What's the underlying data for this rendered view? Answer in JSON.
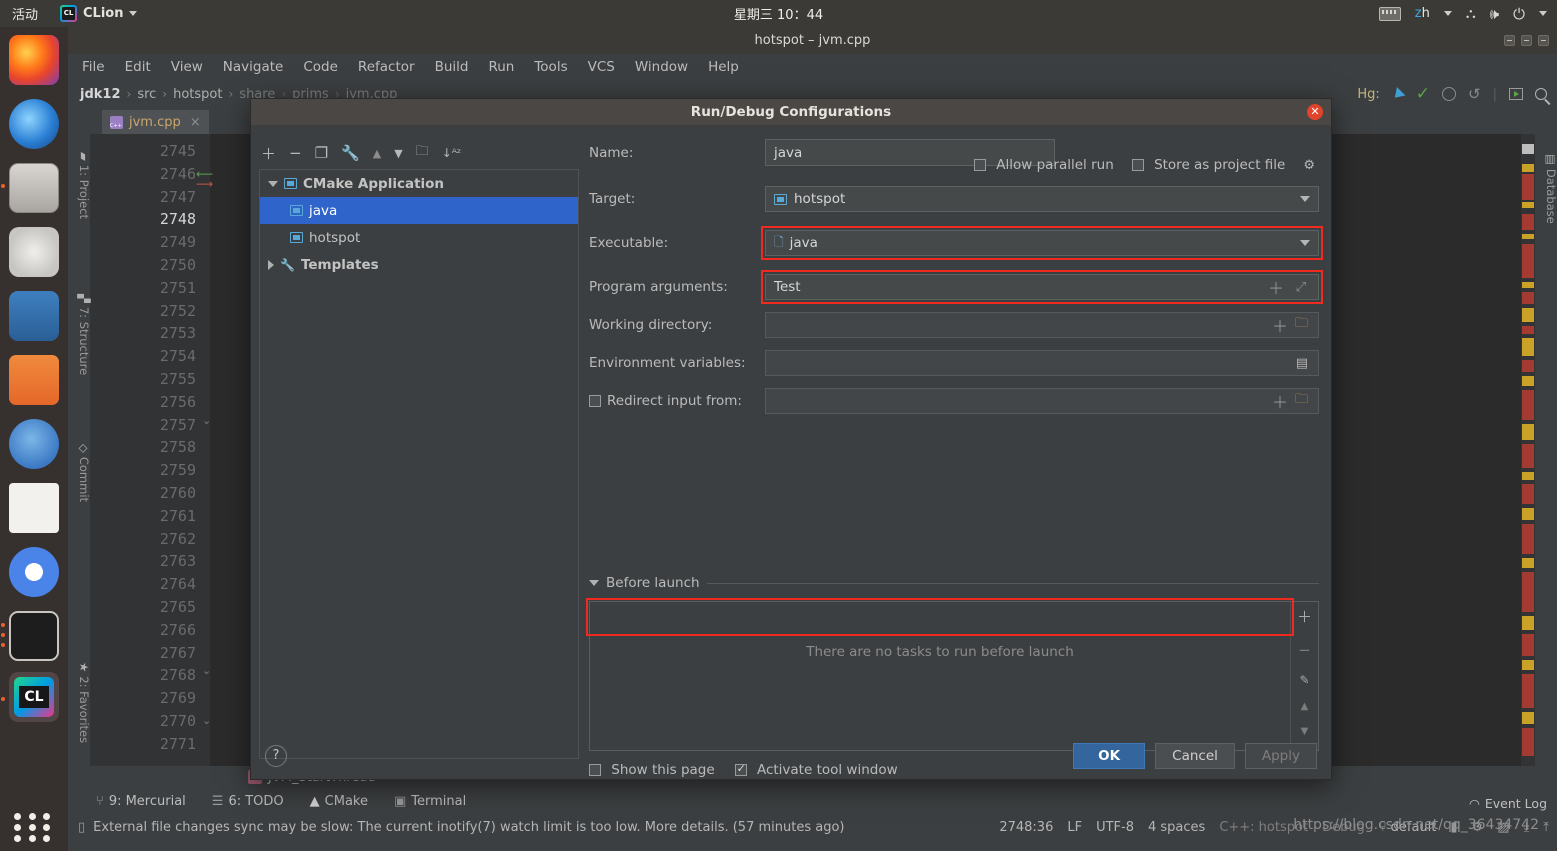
{
  "gnome": {
    "activities": "活动",
    "app_name": "CLion",
    "clock": "星期三 10：44",
    "language": "zh",
    "icons": [
      "keyboard-icon",
      "network-icon",
      "volume-icon",
      "power-icon"
    ]
  },
  "dock": {
    "items": [
      {
        "name": "firefox",
        "running": false
      },
      {
        "name": "thunderbird",
        "running": false
      },
      {
        "name": "files",
        "running": true
      },
      {
        "name": "rhythmbox",
        "running": false
      },
      {
        "name": "libreoffice-writer",
        "running": false
      },
      {
        "name": "ubuntu-software",
        "running": false
      },
      {
        "name": "help",
        "running": false
      },
      {
        "name": "amazon",
        "running": false
      },
      {
        "name": "chromium",
        "running": false
      },
      {
        "name": "terminal",
        "running": true
      },
      {
        "name": "clion",
        "running": true
      }
    ],
    "show_apps": "show-applications-icon"
  },
  "ide": {
    "window_title": "hotspot – jvm.cpp",
    "menu": [
      "File",
      "Edit",
      "View",
      "Navigate",
      "Code",
      "Refactor",
      "Build",
      "Run",
      "Tools",
      "VCS",
      "Window",
      "Help"
    ],
    "breadcrumbs": [
      "jdk12",
      "src",
      "hotspot",
      "share",
      "prims",
      "jvm.cpp"
    ],
    "vcs_label": "Hg:",
    "tab": {
      "label": "jvm.cpp",
      "icon": "cpp-file-icon",
      "close": "×"
    },
    "left_strips": [
      "1: Project",
      "7: Structure",
      "Commit",
      "2: Favorites"
    ],
    "right_strips": [
      "Database"
    ],
    "line_numbers": [
      "2745",
      "2746",
      "2747",
      "2748",
      "2749",
      "2750",
      "2751",
      "2752",
      "2753",
      "2754",
      "2755",
      "2756",
      "2757",
      "2758",
      "2759",
      "2760",
      "2761",
      "2762",
      "2763",
      "2764",
      "2765",
      "2766",
      "2767",
      "2768",
      "2769",
      "2770",
      "2771"
    ],
    "current_line": "2748",
    "structure_breadcrumb": "JVM_StartThread",
    "tool_windows": [
      {
        "label": "9: Mercurial",
        "icon": "branch-icon"
      },
      {
        "label": "6: TODO",
        "icon": "list-icon"
      },
      {
        "label": "CMake",
        "icon": "triangle-icon"
      },
      {
        "label": "Terminal",
        "icon": "terminal-icon"
      }
    ],
    "status": {
      "message": "External file changes sync may be slow: The current inotify(7) watch limit is too low. More details. (57 minutes ago)",
      "caret": "2748:36",
      "line_sep": "LF",
      "encoding": "UTF-8",
      "indent": "4 spaces",
      "build_target": "C++: hotspot",
      "debug": "Debug",
      "branch": "default",
      "event_log": "Event Log"
    },
    "watermark": "https://blog.csdn.net/qq_36434742"
  },
  "dialog": {
    "title": "Run/Debug Configurations",
    "close_icon": "close-icon",
    "toolbar_icons": [
      "add-icon",
      "remove-icon",
      "copy-icon",
      "edit-templates-icon",
      "move-up-icon",
      "move-down-icon",
      "move-into-folder-icon",
      "sort-alphabetically-icon"
    ],
    "tree": [
      {
        "label": "CMake Application",
        "level": 0,
        "expanded": true,
        "selected": false,
        "icon": "cmake-app-icon"
      },
      {
        "label": "java",
        "level": 1,
        "expanded": false,
        "selected": true,
        "icon": "config-icon"
      },
      {
        "label": "hotspot",
        "level": 1,
        "expanded": false,
        "selected": false,
        "icon": "config-icon"
      },
      {
        "label": "Templates",
        "level": 0,
        "expanded": false,
        "selected": false,
        "icon": "wrench-icon"
      }
    ],
    "fields": {
      "name_label": "Name:",
      "name_value": "java",
      "allow_parallel_run": "Allow parallel run",
      "allow_parallel_run_checked": false,
      "store_as_project_file": "Store as project file",
      "store_as_project_file_checked": false,
      "target_label": "Target:",
      "target_value": "hotspot",
      "executable_label": "Executable:",
      "executable_value": "java",
      "program_arguments_label": "Program arguments:",
      "program_arguments_value": "Test",
      "working_directory_label": "Working directory:",
      "working_directory_value": "",
      "environment_variables_label": "Environment variables:",
      "environment_variables_value": "",
      "redirect_input_label": "Redirect input from:",
      "redirect_input_checked": false,
      "redirect_input_value": ""
    },
    "before_launch": {
      "title": "Before launch",
      "empty_text": "There are no tasks to run before launch",
      "buttons": [
        "add-task-icon",
        "remove-task-icon",
        "edit-task-icon",
        "move-up-icon",
        "move-down-icon"
      ],
      "show_this_page": "Show this page",
      "show_this_page_checked": false,
      "activate_tool_window": "Activate tool window",
      "activate_tool_window_checked": true
    },
    "footer": {
      "help": "?",
      "ok": "OK",
      "cancel": "Cancel",
      "apply": "Apply",
      "apply_disabled": true
    }
  },
  "colors": {
    "highlight_red": "#ef2b20",
    "selection_blue": "#2f65ca",
    "primary_button": "#34659c",
    "panel_bg": "#3c3f41",
    "editor_bg": "#2b2b2b"
  }
}
